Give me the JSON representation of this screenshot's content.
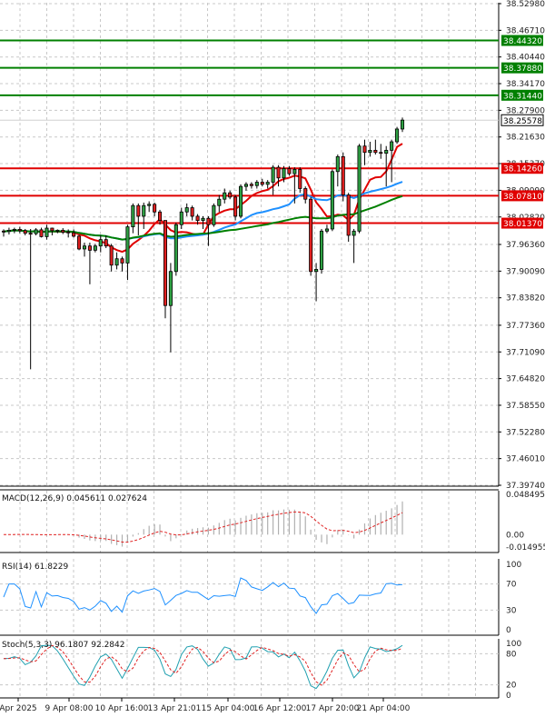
{
  "chart_data": {
    "type": "candlestick",
    "price_axis": {
      "ticks": [
        "38.52980",
        "38.46710",
        "38.40440",
        "38.34170",
        "38.27900",
        "38.21630",
        "38.15370",
        "38.09090",
        "38.02820",
        "37.96360",
        "37.90090",
        "37.83820",
        "37.77360",
        "37.71090",
        "37.64820",
        "37.58550",
        "37.52280",
        "37.46010",
        "37.39740"
      ]
    },
    "time_axis": {
      "labels": [
        "Apr 2025",
        "9 Apr 08:00",
        "10 Apr 16:00",
        "13 Apr 21:01",
        "15 Apr 04:00",
        "16 Apr 12:00",
        "17 Apr 20:00",
        "21 Apr 04:00"
      ]
    },
    "current_price": "38.25578",
    "horizontal_levels": [
      {
        "label": "38.44320",
        "color": "#008000"
      },
      {
        "label": "38.37880",
        "color": "#008000"
      },
      {
        "label": "38.31440",
        "color": "#008000"
      },
      {
        "label": "38.14260",
        "color": "#e00000"
      },
      {
        "label": "38.07810",
        "color": "#e00000"
      },
      {
        "label": "38.01370",
        "color": "#e00000"
      }
    ],
    "candles": [
      [
        37.995,
        37.999,
        37.982,
        37.994
      ],
      [
        37.994,
        38.003,
        37.987,
        37.997
      ],
      [
        37.997,
        38.003,
        37.99,
        37.999
      ],
      [
        37.999,
        38.005,
        37.99,
        37.996
      ],
      [
        37.996,
        38.0,
        37.985,
        37.99
      ],
      [
        37.99,
        38.0,
        37.67,
        37.989
      ],
      [
        37.989,
        38.002,
        37.985,
        37.998
      ],
      [
        37.998,
        38.003,
        37.98,
        37.982
      ],
      [
        37.982,
        38.01,
        37.975,
        38.002
      ],
      [
        38.002,
        38.003,
        37.985,
        37.996
      ],
      [
        37.996,
        37.999,
        37.99,
        37.997
      ],
      [
        37.997,
        38.002,
        37.988,
        37.993
      ],
      [
        37.993,
        37.999,
        37.98,
        37.991
      ],
      [
        37.991,
        37.999,
        37.98,
        37.983
      ],
      [
        37.983,
        37.986,
        37.95,
        37.953
      ],
      [
        37.953,
        37.968,
        37.935,
        37.96
      ],
      [
        37.96,
        37.968,
        37.87,
        37.95
      ],
      [
        37.95,
        37.965,
        37.945,
        37.96
      ],
      [
        37.96,
        37.985,
        37.945,
        37.975
      ],
      [
        37.975,
        37.985,
        37.955,
        37.96
      ],
      [
        37.96,
        37.965,
        37.9,
        37.915
      ],
      [
        37.915,
        37.945,
        37.905,
        37.93
      ],
      [
        37.93,
        37.935,
        37.9,
        37.92
      ],
      [
        37.92,
        38.01,
        37.88,
        38.005
      ],
      [
        38.005,
        38.06,
        37.99,
        38.055
      ],
      [
        38.055,
        38.06,
        37.985,
        38.03
      ],
      [
        38.03,
        38.062,
        38.0,
        38.055
      ],
      [
        38.055,
        38.065,
        38.04,
        38.058
      ],
      [
        38.058,
        38.062,
        38.03,
        38.04
      ],
      [
        38.04,
        38.045,
        38.01,
        38.02
      ],
      [
        38.02,
        38.02,
        37.79,
        37.82
      ],
      [
        37.82,
        37.92,
        37.71,
        37.9
      ],
      [
        37.9,
        38.015,
        37.89,
        38.01
      ],
      [
        38.01,
        38.05,
        38.0,
        38.04
      ],
      [
        38.04,
        38.06,
        38.03,
        38.05
      ],
      [
        38.05,
        38.055,
        38.02,
        38.03
      ],
      [
        38.03,
        38.035,
        38.01,
        38.02
      ],
      [
        38.02,
        38.03,
        38.0,
        38.025
      ],
      [
        38.025,
        38.03,
        37.96,
        38.01
      ],
      [
        38.01,
        38.06,
        38.005,
        38.055
      ],
      [
        38.055,
        38.08,
        38.04,
        38.07
      ],
      [
        38.07,
        38.095,
        38.06,
        38.085
      ],
      [
        38.085,
        38.09,
        38.07,
        38.075
      ],
      [
        38.075,
        38.08,
        38.02,
        38.03
      ],
      [
        38.03,
        38.105,
        38.025,
        38.1
      ],
      [
        38.1,
        38.11,
        38.09,
        38.105
      ],
      [
        38.105,
        38.11,
        38.095,
        38.102
      ],
      [
        38.102,
        38.115,
        38.095,
        38.11
      ],
      [
        38.11,
        38.118,
        38.1,
        38.105
      ],
      [
        38.105,
        38.115,
        38.095,
        38.11
      ],
      [
        38.11,
        38.15,
        38.08,
        38.145
      ],
      [
        38.145,
        38.15,
        38.1,
        38.12
      ],
      [
        38.12,
        38.148,
        38.11,
        38.142
      ],
      [
        38.142,
        38.148,
        38.125,
        38.13
      ],
      [
        38.13,
        38.145,
        38.06,
        38.14
      ],
      [
        38.14,
        38.145,
        38.085,
        38.095
      ],
      [
        38.095,
        38.1,
        38.06,
        38.07
      ],
      [
        38.07,
        38.075,
        37.89,
        37.9
      ],
      [
        37.9,
        37.92,
        37.83,
        37.905
      ],
      [
        37.905,
        38.0,
        37.895,
        37.995
      ],
      [
        37.995,
        38.01,
        37.99,
        38.0
      ],
      [
        38.0,
        38.14,
        37.995,
        38.135
      ],
      [
        38.135,
        38.175,
        38.1,
        38.17
      ],
      [
        38.17,
        38.18,
        38.065,
        38.08
      ],
      [
        38.08,
        38.085,
        37.97,
        37.985
      ],
      [
        37.985,
        38.0,
        37.92,
        37.995
      ],
      [
        37.995,
        38.2,
        37.99,
        38.195
      ],
      [
        38.195,
        38.21,
        38.15,
        38.18
      ],
      [
        38.18,
        38.205,
        38.17,
        38.185
      ],
      [
        38.185,
        38.21,
        38.175,
        38.18
      ],
      [
        38.18,
        38.2,
        38.165,
        38.178
      ],
      [
        38.178,
        38.195,
        38.1,
        38.185
      ],
      [
        38.185,
        38.21,
        38.11,
        38.205
      ],
      [
        38.205,
        38.24,
        38.2,
        38.235
      ],
      [
        38.235,
        38.262,
        38.228,
        38.256
      ]
    ],
    "moving_averages": [
      {
        "color": "#e00000"
      },
      {
        "color": "#1e90ff"
      },
      {
        "color": "#008000"
      }
    ],
    "macd": {
      "label": "MACD(12,26,9) 0.045611 0.027624",
      "axis_ticks": [
        "0.048495",
        "0.00",
        "-0.014955"
      ]
    },
    "rsi": {
      "label": "RSI(14) 61.8229",
      "axis_ticks": [
        "100",
        "70",
        "30",
        "0"
      ]
    },
    "stochastic": {
      "label": "Stoch(5,3,3) 96.1807 92.2842",
      "axis_ticks": [
        "100",
        "80",
        "20",
        "0"
      ]
    }
  }
}
